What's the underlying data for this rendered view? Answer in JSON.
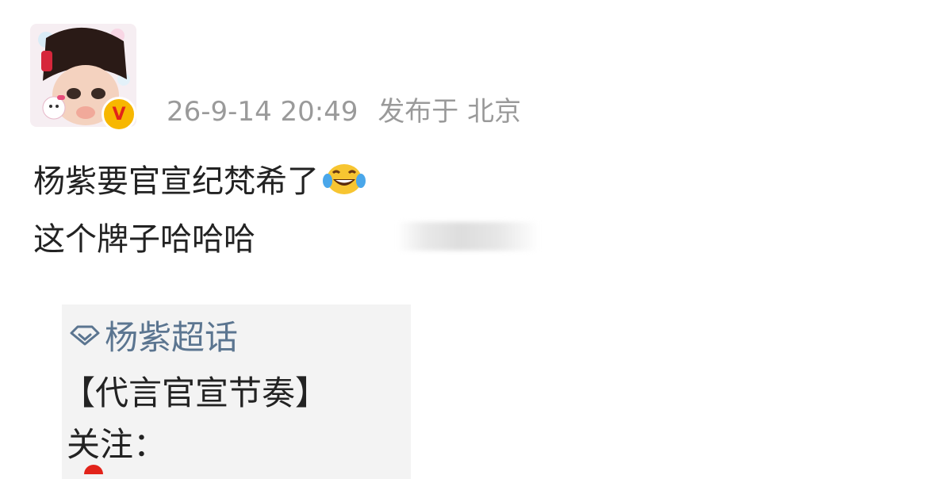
{
  "post": {
    "meta": {
      "timestamp": "26-9-14 20:49",
      "location": "发布于 北京"
    },
    "verified_mark": "V",
    "text_lines": [
      "杨紫要官宣纪梵希了",
      "这个牌子哈哈哈"
    ],
    "emoji": "laughing-tears-emoji"
  },
  "quoted_image": {
    "topic": "杨紫超话",
    "line1": "【代言官宣节奏】",
    "line2": "关注："
  },
  "colors": {
    "meta_gray": "#9a9a9a",
    "topic_blue": "#5b7590",
    "verified_gold": "#f7b700",
    "verified_red": "#e2231a"
  }
}
